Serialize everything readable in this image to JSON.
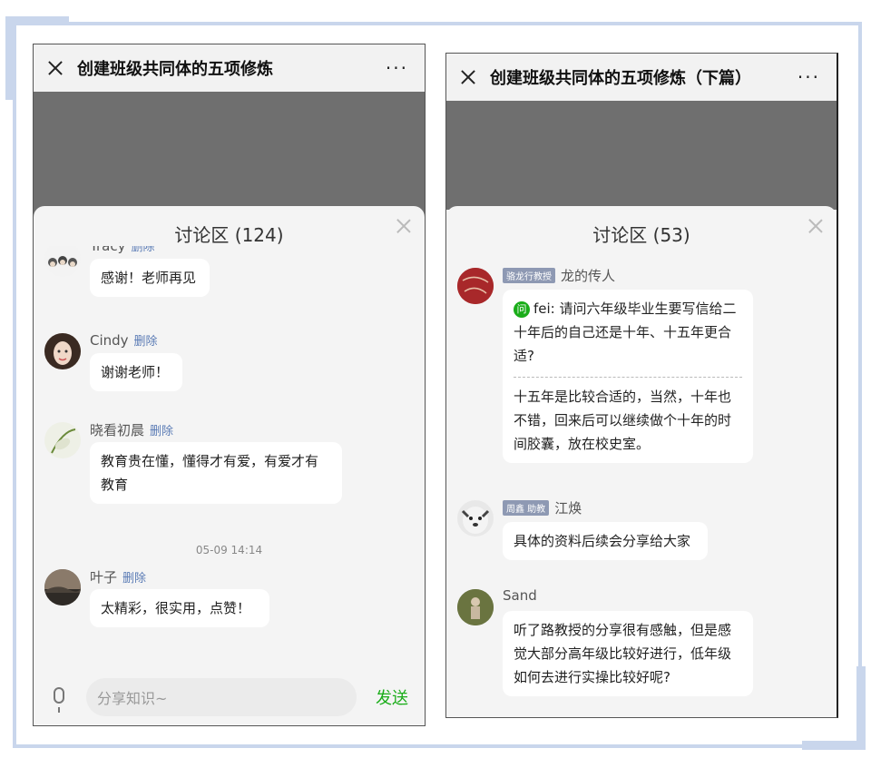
{
  "left": {
    "title": "创建班级共同体的五项修炼",
    "more": "···",
    "sheet_title": "讨论区 (124)",
    "comments": [
      {
        "name": "Tracy",
        "delete": "删除",
        "text": "感谢！老师再见"
      },
      {
        "name": "Cindy",
        "delete": "删除",
        "text": "谢谢老师！"
      },
      {
        "name": "晓看初晨",
        "delete": "删除",
        "text": "教育贵在懂，懂得才有爱，有爱才有教育"
      },
      {
        "name": "叶子",
        "delete": "删除",
        "text": "太精彩，很实用，点赞！"
      }
    ],
    "timestamp": "05-09 14:14",
    "input_placeholder": "分享知识~",
    "send": "发送"
  },
  "right": {
    "title": "创建班级共同体的五项修炼（下篇）",
    "more": "···",
    "sheet_title": "讨论区 (53)",
    "comments": [
      {
        "tag": "骆龙行教授",
        "name": "龙的传人",
        "q_icon": "问",
        "question": "fei: 请问六年级毕业生要写信给二十年后的自己还是十年、十五年更合适?",
        "answer": "十五年是比较合适的，当然，十年也不错，回来后可以继续做个十年的时间胶囊，放在校史室。"
      },
      {
        "tag": "周鑫 助教",
        "name": "江焕",
        "text": "具体的资料后续会分享给大家"
      },
      {
        "name": "Sand",
        "text": "听了路教授的分享很有感触，但是感觉大部分高年级比较好进行，低年级如何去进行实操比较好呢?"
      }
    ]
  },
  "colors": {
    "frame": "#c9d6ec",
    "send": "#1aad19",
    "delete_link": "#5a7bb5",
    "video": "#6f6f6f"
  }
}
